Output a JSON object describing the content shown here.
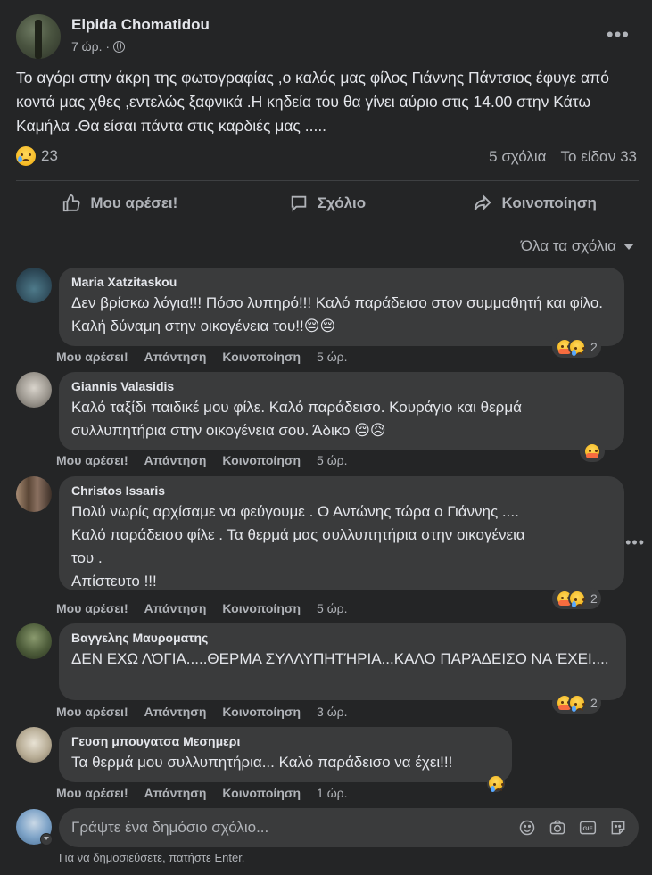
{
  "post": {
    "author": "Elpida Chomatidou",
    "time": "7 ώρ. ·",
    "text": "Το αγόρι στην άκρη της φωτογραφίας ,ο  καλός μας φίλος Γιάννης Πάντσιος έφυγε από κοντά μας χθες ,εντελώς ξαφνικά .Η κηδεία του θα γίνει αύριο στις 14.00 στην Κάτω Καμήλα .Θα είσαι πάντα στις καρδιές μας .....",
    "reactions_count": "23",
    "comments_count": "5 σχόλια",
    "views": "Το είδαν 33"
  },
  "actions": {
    "like": "Μου αρέσει!",
    "comment": "Σχόλιο",
    "share": "Κοινοποίηση"
  },
  "sort_label": "Όλα τα σχόλια",
  "comments": [
    {
      "name": "Maria Xatzitaskou",
      "text": "Δεν βρίσκω λόγια!!! Πόσο λυπηρό!!! Καλό παράδεισο στον συμμαθητή και φίλο. Καλή δύναμη στην οικογένεια του!!😔😔",
      "like": "Μου αρέσει!",
      "reply": "Απάντηση",
      "share": "Κοινοποίηση",
      "time": "5 ώρ.",
      "react_count": "2"
    },
    {
      "name": "Giannis Valasidis",
      "text": "Καλό ταξίδι παιδικέ μου φίλε. Καλό παράδεισο. Κουράγιο και θερμά συλλυπητήρια στην οικογένεια σου. Άδικο 😔😥",
      "like": "Μου αρέσει!",
      "reply": "Απάντηση",
      "share": "Κοινοποίηση",
      "time": "5 ώρ.",
      "react_count": ""
    },
    {
      "name": "Christos Issaris",
      "text_lines": [
        "Πολύ νωρίς αρχίσαμε να φεύγουμε . Ο Αντώνης τώρα ο Γιάννης ....",
        "Καλό παράδεισο φίλε . Τα θερμά μας συλλυπητήρια στην οικογένεια",
        "του .",
        "Απίστευτο !!!"
      ],
      "like": "Μου αρέσει!",
      "reply": "Απάντηση",
      "share": "Κοινοποίηση",
      "time": "5 ώρ.",
      "react_count": "2"
    },
    {
      "name": "Βαγγελης Μαυροματης",
      "text": "ΔΕΝ ΕΧΩ ΛΌΓΙΑ.....ΘΕΡΜΑ ΣΥΛΛΥΠΗΤΉΡΙΑ...ΚΑΛΟ ΠΑΡΆΔΕΙΣΟ ΝΑ ΈΧΕΙ....",
      "like": "Μου αρέσει!",
      "reply": "Απάντηση",
      "share": "Κοινοποίηση",
      "time": "3 ώρ.",
      "react_count": "2"
    },
    {
      "name": "Γευση μπουγατσα Μεσημερι",
      "text": "Τα θερμά μου συλλυπητήρια... Καλό παράδεισο να έχει!!!",
      "like": "Μου αρέσει!",
      "reply": "Απάντηση",
      "share": "Κοινοποίηση",
      "time": "1 ώρ.",
      "react_count": ""
    }
  ],
  "compose": {
    "placeholder": "Γράψτε ένα δημόσιο σχόλιο...",
    "hint": "Για να δημοσιεύσετε, πατήστε Enter.",
    "gif_label": "GIF"
  },
  "colors": {
    "background": "#242526",
    "bubble": "#3a3b3c",
    "text": "#e4e6eb",
    "secondary": "#b0b3b8"
  },
  "icons": [
    "globe-icon",
    "more-icon",
    "like-icon",
    "comment-icon",
    "share-icon",
    "sad-reaction-icon",
    "care-reaction-icon",
    "emoji-icon",
    "camera-icon",
    "gif-icon",
    "sticker-icon"
  ]
}
